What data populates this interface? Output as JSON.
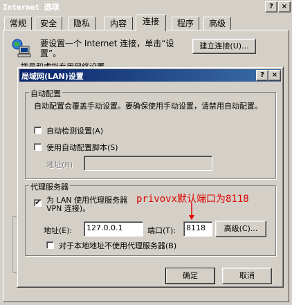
{
  "outer": {
    "title": "Internet 选项",
    "title_buttons": [
      "?",
      "×"
    ],
    "tabs": [
      "常规",
      "安全",
      "隐私",
      "内容",
      "连接",
      "程序",
      "高级"
    ],
    "active_tab": "连接",
    "setup_text": "要设置一个 Internet 连接，单击“设置”。",
    "setup_button": "建立连接(U)...",
    "hidden_text": "拨号和虚拟专用网络设置"
  },
  "dialog": {
    "title": "局域网(LAN)设置",
    "title_buttons": [
      "?",
      "×"
    ],
    "auto": {
      "legend": "自动配置",
      "description": "自动配置会覆盖手动设置。要确保使用手动设置，请禁用自动配置。",
      "auto_detect_label": "自动检测设置(A)",
      "auto_detect_checked": false,
      "auto_script_label": "使用自动配置脚本(S)",
      "auto_script_checked": false,
      "address_label": "地址(R)",
      "address_value": ""
    },
    "proxy": {
      "legend": "代理服务器",
      "use_proxy_label_line1": "为 LAN 使用代理服务器",
      "use_proxy_label_line2": "VPN 连接)。",
      "use_proxy_checked": true,
      "address_label": "地址(E):",
      "address_value": "127.0.0.1",
      "port_label": "端口(T):",
      "port_value": "8118",
      "advanced_button": "高级(C)...",
      "bypass_label": "对于本地地址不使用代理服务器(B)",
      "bypass_checked": false
    },
    "ok_button": "确定",
    "cancel_button": "取消"
  },
  "annotation": {
    "text": "privovx默认端口为8118",
    "color": "#e00000"
  },
  "colors": {
    "face": "#d4d0c8",
    "title_blue": "#0a246a"
  }
}
